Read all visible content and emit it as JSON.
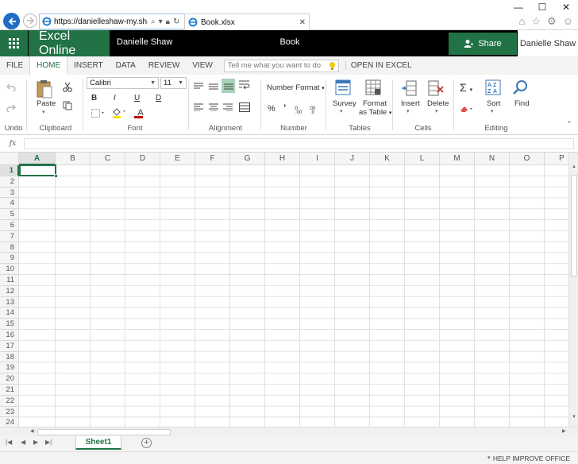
{
  "browser": {
    "url": "https://danielleshaw-my.shar...",
    "tab_title": "Book.xlsx",
    "window_controls": [
      "—",
      "☐",
      "✕"
    ]
  },
  "app": {
    "name": "Excel Online",
    "user": "Danielle Shaw",
    "doc_title": "Book",
    "share_label": "Share",
    "user_right": "Danielle Shaw",
    "accent": "#217346"
  },
  "ribbon_tabs": [
    {
      "label": "FILE",
      "active": false
    },
    {
      "label": "HOME",
      "active": true
    },
    {
      "label": "INSERT",
      "active": false
    },
    {
      "label": "DATA",
      "active": false
    },
    {
      "label": "REVIEW",
      "active": false
    },
    {
      "label": "VIEW",
      "active": false
    }
  ],
  "tellme_placeholder": "Tell me what you want to do",
  "open_in_excel": "OPEN IN EXCEL",
  "ribbon": {
    "undo_group": "Undo",
    "clipboard": {
      "paste": "Paste",
      "group": "Clipboard"
    },
    "font": {
      "name": "Calibri",
      "size": "11",
      "bold": "B",
      "italic": "I",
      "underline": "U",
      "double_underline": "D",
      "font_color": "A",
      "group": "Font"
    },
    "alignment": {
      "group": "Alignment"
    },
    "number": {
      "format": "Number Format",
      "percent": "%",
      "comma": "’",
      "group": "Number"
    },
    "tables": {
      "survey": "Survey",
      "format_as_table_1": "Format",
      "format_as_table_2": "as Table",
      "group": "Tables"
    },
    "cells": {
      "insert": "Insert",
      "delete": "Delete",
      "group": "Cells"
    },
    "editing": {
      "sort": "Sort",
      "find": "Find",
      "group": "Editing",
      "sigma": "Σ"
    }
  },
  "formula_bar": {
    "fx": "fx",
    "value": ""
  },
  "columns": [
    "A",
    "B",
    "C",
    "D",
    "E",
    "F",
    "G",
    "H",
    "I",
    "J",
    "K",
    "L",
    "M",
    "N",
    "O",
    "P"
  ],
  "rows": [
    "1",
    "2",
    "3",
    "4",
    "5",
    "6",
    "7",
    "8",
    "9",
    "10",
    "11",
    "12",
    "13",
    "14",
    "15",
    "16",
    "17",
    "18",
    "19",
    "20",
    "21",
    "22",
    "23",
    "24"
  ],
  "selected_cell": "A1",
  "sheets": [
    {
      "name": "Sheet1",
      "active": true
    }
  ],
  "status": {
    "help": "HELP IMPROVE OFFICE"
  }
}
